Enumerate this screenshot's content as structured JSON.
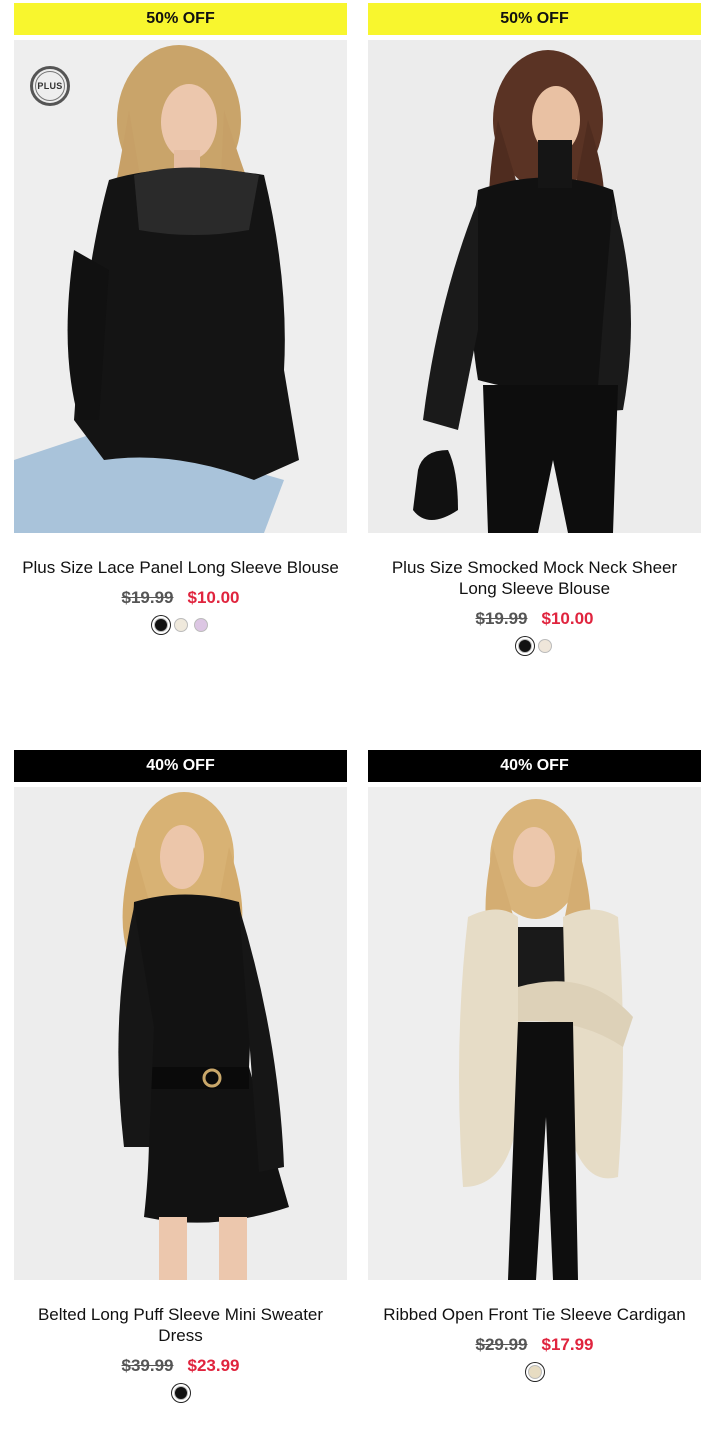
{
  "products": [
    {
      "badge": "50% OFF",
      "badge_color": "#f8f62e",
      "plus_label": "PLUS",
      "title": "Plus Size Lace Panel Long Sleeve Blouse",
      "old_price": "$19.99",
      "new_price": "$10.00",
      "swatches": [
        "#111111",
        "#efe9dc",
        "#dcc6e3"
      ]
    },
    {
      "badge": "50% OFF",
      "badge_color": "#f8f62e",
      "title": "Plus Size Smocked Mock Neck Sheer Long Sleeve Blouse",
      "old_price": "$19.99",
      "new_price": "$10.00",
      "swatches": [
        "#111111",
        "#efe6da"
      ]
    },
    {
      "badge": "40% OFF",
      "badge_color": "#000000",
      "title": "Belted Long Puff Sleeve Mini Sweater Dress",
      "old_price": "$39.99",
      "new_price": "$23.99",
      "swatches": [
        "#111111"
      ]
    },
    {
      "badge": "40% OFF",
      "badge_color": "#000000",
      "title": "Ribbed Open Front Tie Sleeve Cardigan",
      "old_price": "$29.99",
      "new_price": "$17.99",
      "swatches": [
        "#e7dcc2"
      ]
    }
  ],
  "colors": {
    "sale_price": "#e0243e",
    "badge_yellow": "#f8f62e",
    "badge_black": "#000000"
  }
}
